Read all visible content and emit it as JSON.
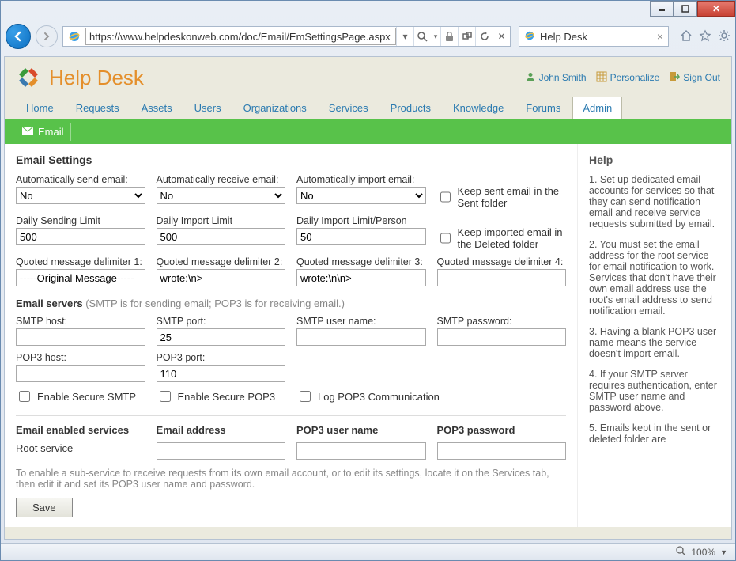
{
  "browser": {
    "url": "https://www.helpdeskonweb.com/doc/Email/EmSettingsPage.aspx",
    "tab_title": "Help Desk",
    "zoom": "100%"
  },
  "header": {
    "brand": "Help Desk",
    "user_name": "John Smith",
    "personalize": "Personalize",
    "sign_out": "Sign Out"
  },
  "main_nav": [
    "Home",
    "Requests",
    "Assets",
    "Users",
    "Organizations",
    "Services",
    "Products",
    "Knowledge",
    "Forums",
    "Admin"
  ],
  "main_nav_active": "Admin",
  "sub_nav": {
    "email": "Email"
  },
  "page_title": "Email Settings",
  "row1": {
    "auto_send_label": "Automatically send email:",
    "auto_send_value": "No",
    "auto_receive_label": "Automatically receive email:",
    "auto_receive_value": "No",
    "auto_import_label": "Automatically import email:",
    "auto_import_value": "No",
    "keep_sent_label": "Keep sent email in the Sent folder"
  },
  "row2": {
    "daily_send_label": "Daily Sending Limit",
    "daily_send_value": "500",
    "daily_import_label": "Daily Import Limit",
    "daily_import_value": "500",
    "daily_import_person_label": "Daily Import Limit/Person",
    "daily_import_person_value": "50",
    "keep_imported_label": "Keep imported email in the Deleted folder"
  },
  "row3": {
    "qd1_label": "Quoted message delimiter 1:",
    "qd1_value": "-----Original Message-----",
    "qd2_label": "Quoted message delimiter 2:",
    "qd2_value": "wrote:\\n>",
    "qd3_label": "Quoted message delimiter 3:",
    "qd3_value": "wrote:\\n\\n>",
    "qd4_label": "Quoted message delimiter 4:",
    "qd4_value": ""
  },
  "servers_heading": "Email servers",
  "servers_note": " (SMTP is for sending email; POP3 is for receiving email.)",
  "smtp": {
    "host_label": "SMTP host:",
    "host_value": "",
    "port_label": "SMTP port:",
    "port_value": "25",
    "user_label": "SMTP user name:",
    "user_value": "",
    "pass_label": "SMTP password:",
    "pass_value": ""
  },
  "pop3": {
    "host_label": "POP3 host:",
    "host_value": "",
    "port_label": "POP3 port:",
    "port_value": "110"
  },
  "secure": {
    "smtp": "Enable Secure SMTP",
    "pop3": "Enable Secure POP3",
    "log": "Log POP3 Communication"
  },
  "services_table": {
    "h1": "Email enabled services",
    "h2": "Email address",
    "h3": "POP3 user name",
    "h4": "POP3 password",
    "root_label": "Root service"
  },
  "hint": "To enable a sub-service to receive requests from its own email account, or to edit its settings, locate it on the Services tab, then edit it and set its POP3 user name and password.",
  "save_label": "Save",
  "help": {
    "title": "Help",
    "p1": "1. Set up dedicated email accounts for services so that they can send notification email and receive service requests submitted by email.",
    "p2": "2. You must set the email address for the root service for email notification to work. Services that don't have their own email address use the root's email address to send notification email.",
    "p3": "3. Having a blank POP3 user name means the service doesn't import email.",
    "p4": "4. If your SMTP server requires authentication, enter SMTP user name and password above.",
    "p5": "5. Emails kept in the sent or deleted folder are"
  }
}
